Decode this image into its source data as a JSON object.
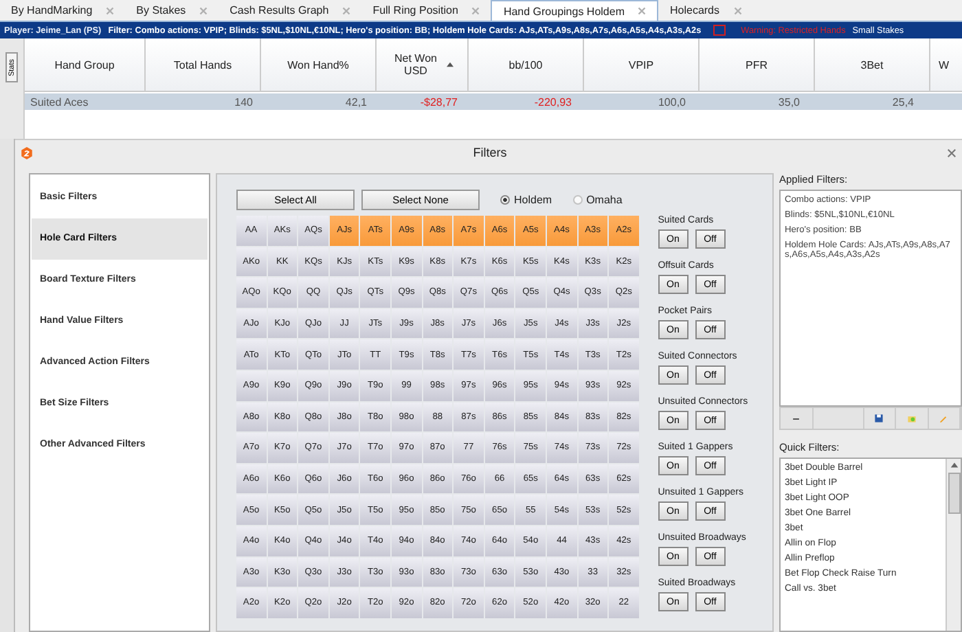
{
  "tabs": [
    {
      "label": "By HandMarking",
      "selected": false
    },
    {
      "label": "By Stakes",
      "selected": false
    },
    {
      "label": "Cash Results Graph",
      "selected": false
    },
    {
      "label": "Full Ring Position",
      "selected": false
    },
    {
      "label": "Hand Groupings Holdem",
      "selected": true
    },
    {
      "label": "Holecards",
      "selected": false
    }
  ],
  "filter_bar": {
    "player": "Player: Jeime_Lan (PS)",
    "filter": "Filter: Combo actions: VPIP; Blinds: $5NL,$10NL,€10NL; Hero's position: BB; Holdem Hole Cards: AJs,ATs,A9s,A8s,A7s,A6s,A5s,A4s,A3s,A2s",
    "warning_checked": false,
    "warning": "Warning: Restricted Hands",
    "stakes": "Small Stakes"
  },
  "side_button": "Stats",
  "table": {
    "columns": [
      {
        "label": "Hand Group",
        "sorted": false
      },
      {
        "label": "Total Hands",
        "sorted": false
      },
      {
        "label": "Won Hand%",
        "sorted": false
      },
      {
        "label": "Net Won USD",
        "sorted": true
      },
      {
        "label": "bb/100",
        "sorted": false
      },
      {
        "label": "VPIP",
        "sorted": false
      },
      {
        "label": "PFR",
        "sorted": false
      },
      {
        "label": "3Bet",
        "sorted": false
      },
      {
        "label": "W",
        "sorted": false
      }
    ],
    "rows": [
      [
        {
          "text": "Suited Aces",
          "negative": false
        },
        {
          "text": "140",
          "negative": false
        },
        {
          "text": "42,1",
          "negative": false
        },
        {
          "text": "-$28,77",
          "negative": true
        },
        {
          "text": "-220,93",
          "negative": true
        },
        {
          "text": "100,0",
          "negative": false
        },
        {
          "text": "35,0",
          "negative": false
        },
        {
          "text": "25,4",
          "negative": false
        }
      ]
    ]
  },
  "dialog": {
    "title": "Filters",
    "categories": [
      {
        "label": "Basic Filters",
        "selected": false
      },
      {
        "label": "Hole Card Filters",
        "selected": true
      },
      {
        "label": "Board Texture Filters",
        "selected": false
      },
      {
        "label": "Hand Value Filters",
        "selected": false
      },
      {
        "label": "Advanced Action Filters",
        "selected": false
      },
      {
        "label": "Bet Size Filters",
        "selected": false
      },
      {
        "label": "Other Advanced Filters",
        "selected": false
      }
    ],
    "select_buttons": [
      "Select All",
      "Select None"
    ],
    "game_options": [
      {
        "label": "Holdem",
        "selected": true
      },
      {
        "label": "Omaha",
        "selected": false
      }
    ],
    "grid": [
      [
        {
          "label": "AA",
          "selected": false
        },
        {
          "label": "AKs",
          "selected": false
        },
        {
          "label": "AQs",
          "selected": false
        },
        {
          "label": "AJs",
          "selected": true
        },
        {
          "label": "ATs",
          "selected": true
        },
        {
          "label": "A9s",
          "selected": true
        },
        {
          "label": "A8s",
          "selected": true
        },
        {
          "label": "A7s",
          "selected": true
        },
        {
          "label": "A6s",
          "selected": true
        },
        {
          "label": "A5s",
          "selected": true
        },
        {
          "label": "A4s",
          "selected": true
        },
        {
          "label": "A3s",
          "selected": true
        },
        {
          "label": "A2s",
          "selected": true
        }
      ],
      [
        {
          "label": "AKo",
          "selected": false
        },
        {
          "label": "KK",
          "selected": false
        },
        {
          "label": "KQs",
          "selected": false
        },
        {
          "label": "KJs",
          "selected": false
        },
        {
          "label": "KTs",
          "selected": false
        },
        {
          "label": "K9s",
          "selected": false
        },
        {
          "label": "K8s",
          "selected": false
        },
        {
          "label": "K7s",
          "selected": false
        },
        {
          "label": "K6s",
          "selected": false
        },
        {
          "label": "K5s",
          "selected": false
        },
        {
          "label": "K4s",
          "selected": false
        },
        {
          "label": "K3s",
          "selected": false
        },
        {
          "label": "K2s",
          "selected": false
        }
      ],
      [
        {
          "label": "AQo",
          "selected": false
        },
        {
          "label": "KQo",
          "selected": false
        },
        {
          "label": "QQ",
          "selected": false
        },
        {
          "label": "QJs",
          "selected": false
        },
        {
          "label": "QTs",
          "selected": false
        },
        {
          "label": "Q9s",
          "selected": false
        },
        {
          "label": "Q8s",
          "selected": false
        },
        {
          "label": "Q7s",
          "selected": false
        },
        {
          "label": "Q6s",
          "selected": false
        },
        {
          "label": "Q5s",
          "selected": false
        },
        {
          "label": "Q4s",
          "selected": false
        },
        {
          "label": "Q3s",
          "selected": false
        },
        {
          "label": "Q2s",
          "selected": false
        }
      ],
      [
        {
          "label": "AJo",
          "selected": false
        },
        {
          "label": "KJo",
          "selected": false
        },
        {
          "label": "QJo",
          "selected": false
        },
        {
          "label": "JJ",
          "selected": false
        },
        {
          "label": "JTs",
          "selected": false
        },
        {
          "label": "J9s",
          "selected": false
        },
        {
          "label": "J8s",
          "selected": false
        },
        {
          "label": "J7s",
          "selected": false
        },
        {
          "label": "J6s",
          "selected": false
        },
        {
          "label": "J5s",
          "selected": false
        },
        {
          "label": "J4s",
          "selected": false
        },
        {
          "label": "J3s",
          "selected": false
        },
        {
          "label": "J2s",
          "selected": false
        }
      ],
      [
        {
          "label": "ATo",
          "selected": false
        },
        {
          "label": "KTo",
          "selected": false
        },
        {
          "label": "QTo",
          "selected": false
        },
        {
          "label": "JTo",
          "selected": false
        },
        {
          "label": "TT",
          "selected": false
        },
        {
          "label": "T9s",
          "selected": false
        },
        {
          "label": "T8s",
          "selected": false
        },
        {
          "label": "T7s",
          "selected": false
        },
        {
          "label": "T6s",
          "selected": false
        },
        {
          "label": "T5s",
          "selected": false
        },
        {
          "label": "T4s",
          "selected": false
        },
        {
          "label": "T3s",
          "selected": false
        },
        {
          "label": "T2s",
          "selected": false
        }
      ],
      [
        {
          "label": "A9o",
          "selected": false
        },
        {
          "label": "K9o",
          "selected": false
        },
        {
          "label": "Q9o",
          "selected": false
        },
        {
          "label": "J9o",
          "selected": false
        },
        {
          "label": "T9o",
          "selected": false
        },
        {
          "label": "99",
          "selected": false
        },
        {
          "label": "98s",
          "selected": false
        },
        {
          "label": "97s",
          "selected": false
        },
        {
          "label": "96s",
          "selected": false
        },
        {
          "label": "95s",
          "selected": false
        },
        {
          "label": "94s",
          "selected": false
        },
        {
          "label": "93s",
          "selected": false
        },
        {
          "label": "92s",
          "selected": false
        }
      ],
      [
        {
          "label": "A8o",
          "selected": false
        },
        {
          "label": "K8o",
          "selected": false
        },
        {
          "label": "Q8o",
          "selected": false
        },
        {
          "label": "J8o",
          "selected": false
        },
        {
          "label": "T8o",
          "selected": false
        },
        {
          "label": "98o",
          "selected": false
        },
        {
          "label": "88",
          "selected": false
        },
        {
          "label": "87s",
          "selected": false
        },
        {
          "label": "86s",
          "selected": false
        },
        {
          "label": "85s",
          "selected": false
        },
        {
          "label": "84s",
          "selected": false
        },
        {
          "label": "83s",
          "selected": false
        },
        {
          "label": "82s",
          "selected": false
        }
      ],
      [
        {
          "label": "A7o",
          "selected": false
        },
        {
          "label": "K7o",
          "selected": false
        },
        {
          "label": "Q7o",
          "selected": false
        },
        {
          "label": "J7o",
          "selected": false
        },
        {
          "label": "T7o",
          "selected": false
        },
        {
          "label": "97o",
          "selected": false
        },
        {
          "label": "87o",
          "selected": false
        },
        {
          "label": "77",
          "selected": false
        },
        {
          "label": "76s",
          "selected": false
        },
        {
          "label": "75s",
          "selected": false
        },
        {
          "label": "74s",
          "selected": false
        },
        {
          "label": "73s",
          "selected": false
        },
        {
          "label": "72s",
          "selected": false
        }
      ],
      [
        {
          "label": "A6o",
          "selected": false
        },
        {
          "label": "K6o",
          "selected": false
        },
        {
          "label": "Q6o",
          "selected": false
        },
        {
          "label": "J6o",
          "selected": false
        },
        {
          "label": "T6o",
          "selected": false
        },
        {
          "label": "96o",
          "selected": false
        },
        {
          "label": "86o",
          "selected": false
        },
        {
          "label": "76o",
          "selected": false
        },
        {
          "label": "66",
          "selected": false
        },
        {
          "label": "65s",
          "selected": false
        },
        {
          "label": "64s",
          "selected": false
        },
        {
          "label": "63s",
          "selected": false
        },
        {
          "label": "62s",
          "selected": false
        }
      ],
      [
        {
          "label": "A5o",
          "selected": false
        },
        {
          "label": "K5o",
          "selected": false
        },
        {
          "label": "Q5o",
          "selected": false
        },
        {
          "label": "J5o",
          "selected": false
        },
        {
          "label": "T5o",
          "selected": false
        },
        {
          "label": "95o",
          "selected": false
        },
        {
          "label": "85o",
          "selected": false
        },
        {
          "label": "75o",
          "selected": false
        },
        {
          "label": "65o",
          "selected": false
        },
        {
          "label": "55",
          "selected": false
        },
        {
          "label": "54s",
          "selected": false
        },
        {
          "label": "53s",
          "selected": false
        },
        {
          "label": "52s",
          "selected": false
        }
      ],
      [
        {
          "label": "A4o",
          "selected": false
        },
        {
          "label": "K4o",
          "selected": false
        },
        {
          "label": "Q4o",
          "selected": false
        },
        {
          "label": "J4o",
          "selected": false
        },
        {
          "label": "T4o",
          "selected": false
        },
        {
          "label": "94o",
          "selected": false
        },
        {
          "label": "84o",
          "selected": false
        },
        {
          "label": "74o",
          "selected": false
        },
        {
          "label": "64o",
          "selected": false
        },
        {
          "label": "54o",
          "selected": false
        },
        {
          "label": "44",
          "selected": false
        },
        {
          "label": "43s",
          "selected": false
        },
        {
          "label": "42s",
          "selected": false
        }
      ],
      [
        {
          "label": "A3o",
          "selected": false
        },
        {
          "label": "K3o",
          "selected": false
        },
        {
          "label": "Q3o",
          "selected": false
        },
        {
          "label": "J3o",
          "selected": false
        },
        {
          "label": "T3o",
          "selected": false
        },
        {
          "label": "93o",
          "selected": false
        },
        {
          "label": "83o",
          "selected": false
        },
        {
          "label": "73o",
          "selected": false
        },
        {
          "label": "63o",
          "selected": false
        },
        {
          "label": "53o",
          "selected": false
        },
        {
          "label": "43o",
          "selected": false
        },
        {
          "label": "33",
          "selected": false
        },
        {
          "label": "32s",
          "selected": false
        }
      ],
      [
        {
          "label": "A2o",
          "selected": false
        },
        {
          "label": "K2o",
          "selected": false
        },
        {
          "label": "Q2o",
          "selected": false
        },
        {
          "label": "J2o",
          "selected": false
        },
        {
          "label": "T2o",
          "selected": false
        },
        {
          "label": "92o",
          "selected": false
        },
        {
          "label": "82o",
          "selected": false
        },
        {
          "label": "72o",
          "selected": false
        },
        {
          "label": "62o",
          "selected": false
        },
        {
          "label": "52o",
          "selected": false
        },
        {
          "label": "42o",
          "selected": false
        },
        {
          "label": "32o",
          "selected": false
        },
        {
          "label": "22",
          "selected": false
        }
      ]
    ],
    "toggle_groups": [
      {
        "label": "Suited Cards",
        "buttons": [
          "On",
          "Off"
        ]
      },
      {
        "label": "Offsuit Cards",
        "buttons": [
          "On",
          "Off"
        ]
      },
      {
        "label": "Pocket Pairs",
        "buttons": [
          "On",
          "Off"
        ]
      },
      {
        "label": "Suited Connectors",
        "buttons": [
          "On",
          "Off"
        ]
      },
      {
        "label": "Unsuited Connectors",
        "buttons": [
          "On",
          "Off"
        ]
      },
      {
        "label": "Suited 1 Gappers",
        "buttons": [
          "On",
          "Off"
        ]
      },
      {
        "label": "Unsuited 1 Gappers",
        "buttons": [
          "On",
          "Off"
        ]
      },
      {
        "label": "Unsuited Broadways",
        "buttons": [
          "On",
          "Off"
        ]
      },
      {
        "label": "Suited Broadways",
        "buttons": [
          "On",
          "Off"
        ]
      }
    ],
    "applied_filters": {
      "heading": "Applied Filters:",
      "items": [
        "Combo actions: VPIP",
        "Blinds: $5NL,$10NL,€10NL",
        "Hero's position: BB",
        "Holdem Hole Cards: AJs,ATs,A9s,A8s,A7s,A6s,A5s,A4s,A3s,A2s"
      ],
      "remove_button": "−"
    },
    "quick_filters": {
      "heading": "Quick Filters:",
      "items": [
        "3bet Double Barrel",
        "3bet Light IP",
        "3bet Light OOP",
        "3bet One Barrel",
        "3bet",
        "Allin on Flop",
        "Allin Preflop",
        "Bet Flop Check Raise Turn",
        "Call vs. 3bet"
      ]
    }
  }
}
